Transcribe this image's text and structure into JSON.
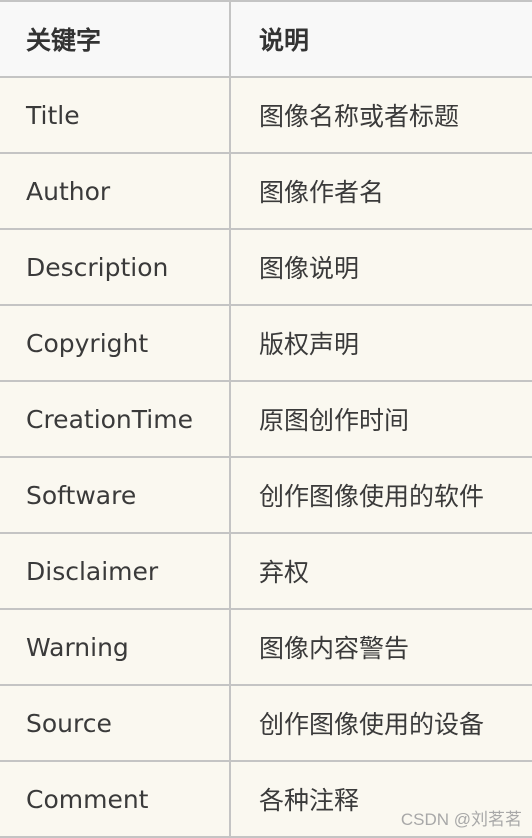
{
  "table": {
    "headers": [
      "关键字",
      "说明"
    ],
    "rows": [
      {
        "keyword": "Title",
        "description": "图像名称或者标题"
      },
      {
        "keyword": "Author",
        "description": "图像作者名"
      },
      {
        "keyword": "Description",
        "description": "图像说明"
      },
      {
        "keyword": "Copyright",
        "description": "版权声明"
      },
      {
        "keyword": "CreationTime",
        "description": "原图创作时间"
      },
      {
        "keyword": "Software",
        "description": "创作图像使用的软件"
      },
      {
        "keyword": "Disclaimer",
        "description": "弃权"
      },
      {
        "keyword": "Warning",
        "description": "图像内容警告"
      },
      {
        "keyword": "Source",
        "description": "创作图像使用的设备"
      },
      {
        "keyword": "Comment",
        "description": "各种注释"
      }
    ]
  },
  "watermark": "CSDN @刘茗茗"
}
